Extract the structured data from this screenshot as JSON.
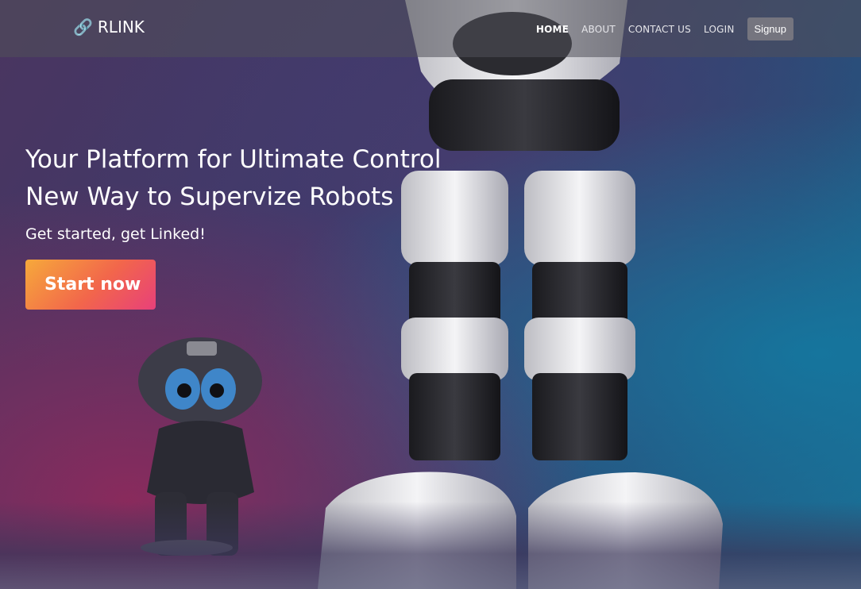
{
  "brand": {
    "name": "RLINK",
    "icon": "link-icon"
  },
  "nav": {
    "items": [
      {
        "label": "HOME",
        "active": true
      },
      {
        "label": "ABOUT",
        "active": false
      },
      {
        "label": "CONTACT US",
        "active": false
      },
      {
        "label": "LOGIN",
        "active": false
      }
    ],
    "signup_label": "Signup"
  },
  "hero": {
    "headline_line1": "Your Platform for Ultimate Control",
    "headline_line2": "New Way to Supervize Robots",
    "subtitle": "Get started, get Linked!",
    "cta_label": "Start now"
  },
  "colors": {
    "cta_gradient": [
      "#f6a93b",
      "#f2664b",
      "#e8407a"
    ],
    "navbar_bg": "#50505a",
    "signup_bg": "#75757f"
  }
}
